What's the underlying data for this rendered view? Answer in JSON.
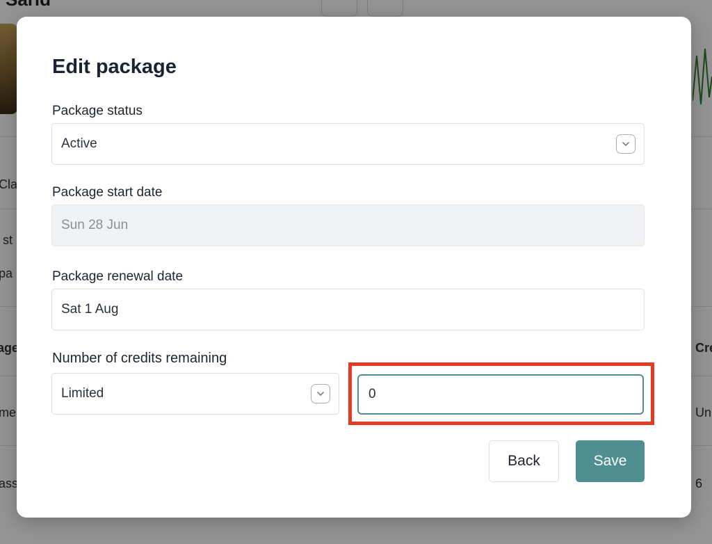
{
  "background": {
    "title": "Sarid",
    "fragments": [
      "Cla",
      "st",
      "pa",
      "age",
      "me",
      "ass",
      "Cre",
      "Un",
      "6"
    ]
  },
  "modal": {
    "title": "Edit package",
    "status": {
      "label": "Package status",
      "value": "Active"
    },
    "start_date": {
      "label": "Package start date",
      "value": "Sun 28 Jun"
    },
    "renewal_date": {
      "label": "Package renewal date",
      "value": "Sat 1 Aug"
    },
    "credits": {
      "label": "Number of credits remaining",
      "mode": "Limited",
      "value": "0"
    },
    "buttons": {
      "back": "Back",
      "save": "Save"
    }
  },
  "colors": {
    "accent": "#4f8e91",
    "highlight": "#e63a22"
  },
  "icons": {
    "dropdown": "chevron-down-icon"
  }
}
